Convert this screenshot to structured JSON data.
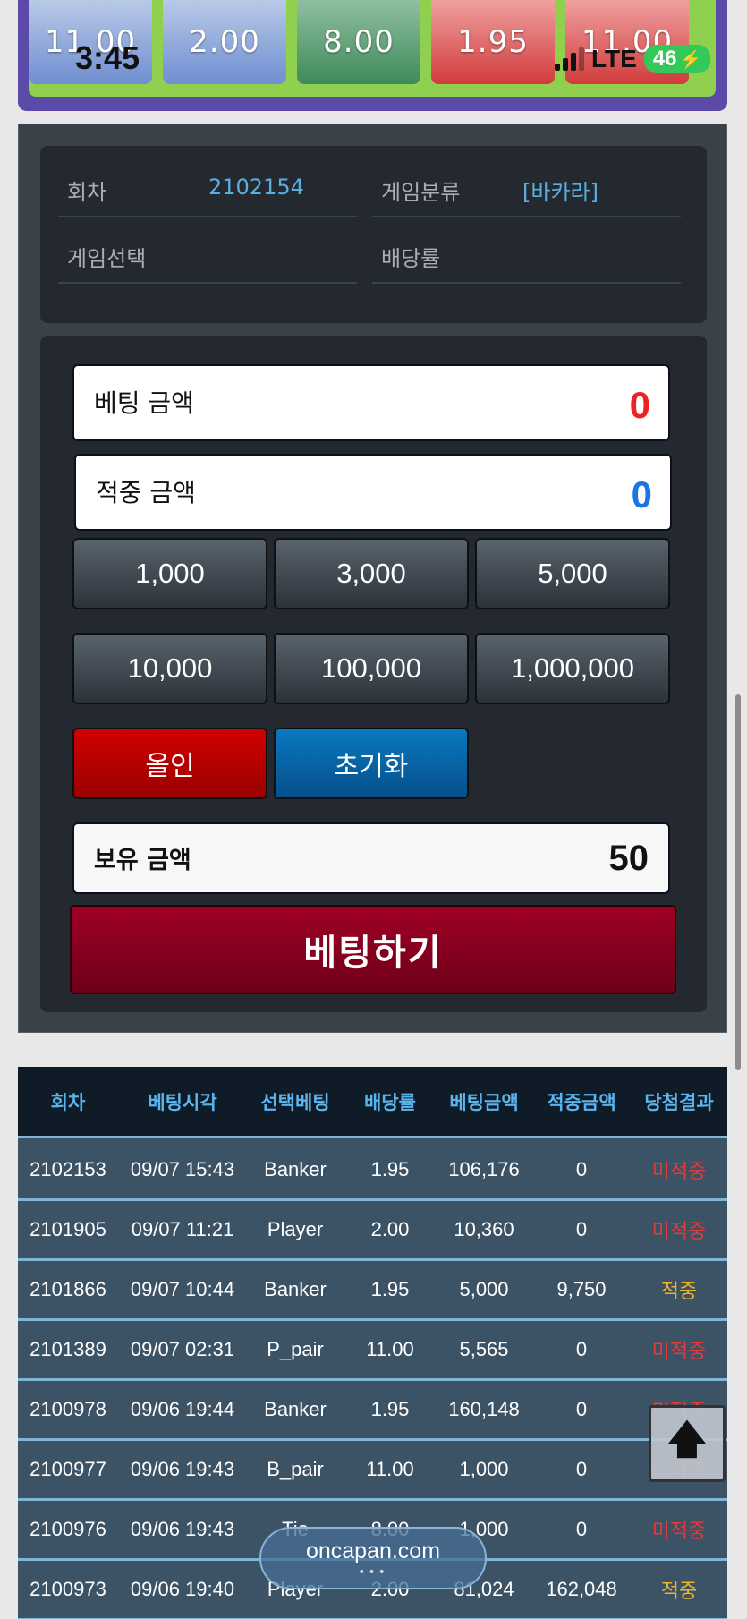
{
  "status_bar": {
    "time": "3:45",
    "network": "LTE",
    "battery": "46"
  },
  "odds_bar": {
    "buttons": [
      {
        "value": "11.00",
        "color": "blue"
      },
      {
        "value": "2.00",
        "color": "blue"
      },
      {
        "value": "8.00",
        "color": "green"
      },
      {
        "value": "1.95",
        "color": "red"
      },
      {
        "value": "11.00",
        "color": "red"
      }
    ]
  },
  "info": {
    "round_label": "회차",
    "round_value": "2102154",
    "category_label": "게임분류",
    "category_value": "[바카라]",
    "selection_label": "게임선택",
    "selection_value": "",
    "odds_label": "배당률",
    "odds_value": ""
  },
  "bet_panel": {
    "bet_amount_label": "베팅 금액",
    "bet_amount_value": "0",
    "win_amount_label": "적중 금액",
    "win_amount_value": "0",
    "chips": [
      "1,000",
      "3,000",
      "5,000",
      "10,000",
      "100,000",
      "1,000,000"
    ],
    "allin_label": "올인",
    "reset_label": "초기화",
    "hold_label": "보유 금액",
    "hold_value": "50",
    "submit_label": "베팅하기"
  },
  "history": {
    "columns": [
      "회차",
      "베팅시각",
      "선택베팅",
      "배당률",
      "베팅금액",
      "적중금액",
      "당첨결과"
    ],
    "rows": [
      {
        "round": "2102153",
        "time": "09/07 15:43",
        "pick": "Banker",
        "odds": "1.95",
        "bet": "106,176",
        "win": "0",
        "result": "미적중",
        "won": false
      },
      {
        "round": "2101905",
        "time": "09/07 11:21",
        "pick": "Player",
        "odds": "2.00",
        "bet": "10,360",
        "win": "0",
        "result": "미적중",
        "won": false
      },
      {
        "round": "2101866",
        "time": "09/07 10:44",
        "pick": "Banker",
        "odds": "1.95",
        "bet": "5,000",
        "win": "9,750",
        "result": "적중",
        "won": true
      },
      {
        "round": "2101389",
        "time": "09/07 02:31",
        "pick": "P_pair",
        "odds": "11.00",
        "bet": "5,565",
        "win": "0",
        "result": "미적중",
        "won": false
      },
      {
        "round": "2100978",
        "time": "09/06 19:44",
        "pick": "Banker",
        "odds": "1.95",
        "bet": "160,148",
        "win": "0",
        "result": "미적중",
        "won": false
      },
      {
        "round": "2100977",
        "time": "09/06 19:43",
        "pick": "B_pair",
        "odds": "11.00",
        "bet": "1,000",
        "win": "0",
        "result": "미적중",
        "won": false
      },
      {
        "round": "2100976",
        "time": "09/06 19:43",
        "pick": "Tie",
        "odds": "8.00",
        "bet": "1,000",
        "win": "0",
        "result": "미적중",
        "won": false
      },
      {
        "round": "2100973",
        "time": "09/06 19:40",
        "pick": "Player",
        "odds": "2.00",
        "bet": "81,024",
        "win": "162,048",
        "result": "적중",
        "won": true
      }
    ]
  },
  "browser": {
    "url": "oncapan.com",
    "more_icon": "•••"
  },
  "colors": {
    "accent_blue": "#5ab4ee",
    "lose_red": "#e43a3a",
    "win_gold": "#f0b429",
    "bet_red": "#a00025"
  },
  "icons": {
    "scroll_top": "arrow-up-icon"
  }
}
